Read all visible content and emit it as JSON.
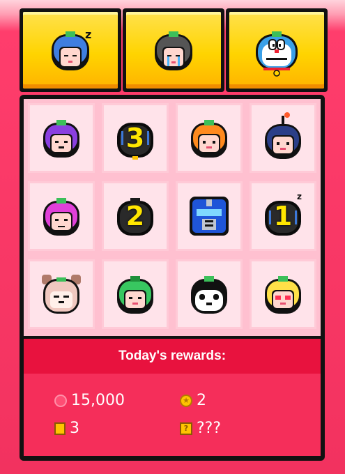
{
  "top_characters": [
    {
      "name": "sleepy-blue",
      "badge": "z"
    },
    {
      "name": "crying-gray",
      "badge": ""
    },
    {
      "name": "doraemon",
      "badge": ""
    }
  ],
  "grid": [
    {
      "character": "purple-grumpy",
      "number": ""
    },
    {
      "character": "dark-locked",
      "number": "3"
    },
    {
      "character": "orange",
      "number": ""
    },
    {
      "character": "bomb-navy",
      "number": ""
    },
    {
      "character": "magenta-sad",
      "number": ""
    },
    {
      "character": "dark-locked",
      "number": "2"
    },
    {
      "character": "robot-blue",
      "number": ""
    },
    {
      "character": "dark-locked-sleepy",
      "number": "1"
    },
    {
      "character": "bear-hood",
      "number": ""
    },
    {
      "character": "green",
      "number": ""
    },
    {
      "character": "panda",
      "number": ""
    },
    {
      "character": "yellow-hearts",
      "number": ""
    }
  ],
  "rewards": {
    "header": "Today's rewards:",
    "items": [
      {
        "icon": "tomato-icon",
        "value": "15,000"
      },
      {
        "icon": "star-coin-icon",
        "value": "2"
      },
      {
        "icon": "book-icon",
        "value": "3"
      },
      {
        "icon": "mystery-box-icon",
        "value": "???"
      }
    ]
  },
  "colors": {
    "background": "#f2325f",
    "card_yellow": "#ffd400",
    "cell_pink": "#ffe3ea",
    "header_red": "#e8123e",
    "number_yellow": "#ffe600"
  }
}
